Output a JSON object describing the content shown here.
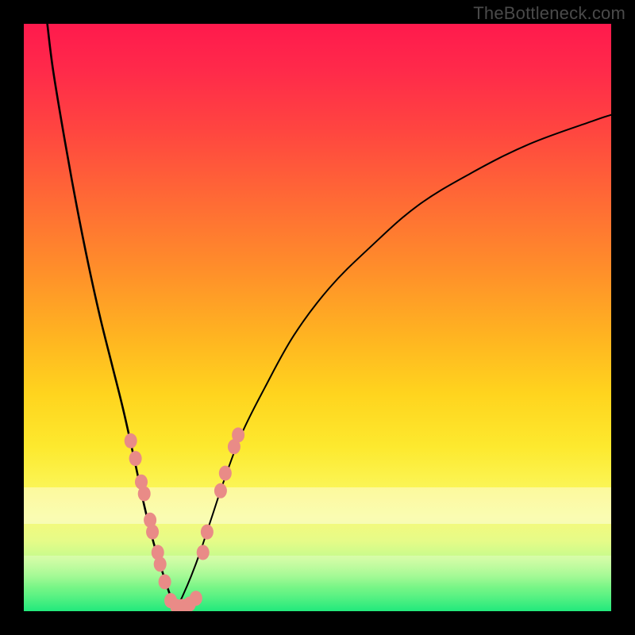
{
  "watermark": "TheBottleneck.com",
  "colors": {
    "frame": "#000000",
    "curve": "#000000",
    "marker_fill": "#e98b87",
    "marker_stroke": "#d46e6a",
    "gradient_top": "#ff1a4d",
    "gradient_bottom": "#22e97c"
  },
  "chart_data": {
    "type": "line",
    "title": "",
    "xlabel": "",
    "ylabel": "",
    "xlim": [
      0,
      100
    ],
    "ylim": [
      0,
      100
    ],
    "grid": false,
    "legend": false,
    "notes": "Two unlabeled curves meeting near x≈26 at y≈0 on a rainbow gradient; background color encodes value (red high → green low). Pink markers cluster along both curves in the lower yellow/green region. Values are read by pixel position; axes carry no tick labels.",
    "series": [
      {
        "name": "left-curve",
        "x": [
          4,
          5,
          7,
          9,
          11,
          13,
          15,
          17,
          19,
          20.5,
          22,
          23.5,
          25,
          26
        ],
        "y": [
          100,
          92,
          80,
          69,
          59,
          50,
          42,
          34,
          25,
          18,
          12,
          7,
          2.5,
          0.5
        ]
      },
      {
        "name": "right-curve",
        "x": [
          26,
          27,
          28.5,
          30,
          32,
          34,
          37,
          41,
          46,
          52,
          59,
          67,
          76,
          86,
          97,
          100
        ],
        "y": [
          0.5,
          2.5,
          6,
          10,
          16,
          22,
          30,
          38,
          47,
          55,
          62,
          69,
          74.5,
          79.5,
          83.5,
          84.5
        ]
      }
    ],
    "markers": {
      "name": "highlight-points",
      "shape": "rounded",
      "points": [
        {
          "x": 18.2,
          "y": 29.0
        },
        {
          "x": 19.0,
          "y": 26.0
        },
        {
          "x": 20.0,
          "y": 22.0
        },
        {
          "x": 20.5,
          "y": 20.0
        },
        {
          "x": 21.5,
          "y": 15.5
        },
        {
          "x": 21.9,
          "y": 13.5
        },
        {
          "x": 22.8,
          "y": 10.0
        },
        {
          "x": 23.2,
          "y": 8.0
        },
        {
          "x": 24.0,
          "y": 5.0
        },
        {
          "x": 25.0,
          "y": 1.8
        },
        {
          "x": 26.0,
          "y": 0.8
        },
        {
          "x": 27.0,
          "y": 0.8
        },
        {
          "x": 28.2,
          "y": 1.2
        },
        {
          "x": 29.3,
          "y": 2.2
        },
        {
          "x": 30.5,
          "y": 10.0
        },
        {
          "x": 31.2,
          "y": 13.5
        },
        {
          "x": 33.5,
          "y": 20.5
        },
        {
          "x": 34.3,
          "y": 23.5
        },
        {
          "x": 35.8,
          "y": 28.0
        },
        {
          "x": 36.5,
          "y": 30.0
        }
      ]
    }
  }
}
